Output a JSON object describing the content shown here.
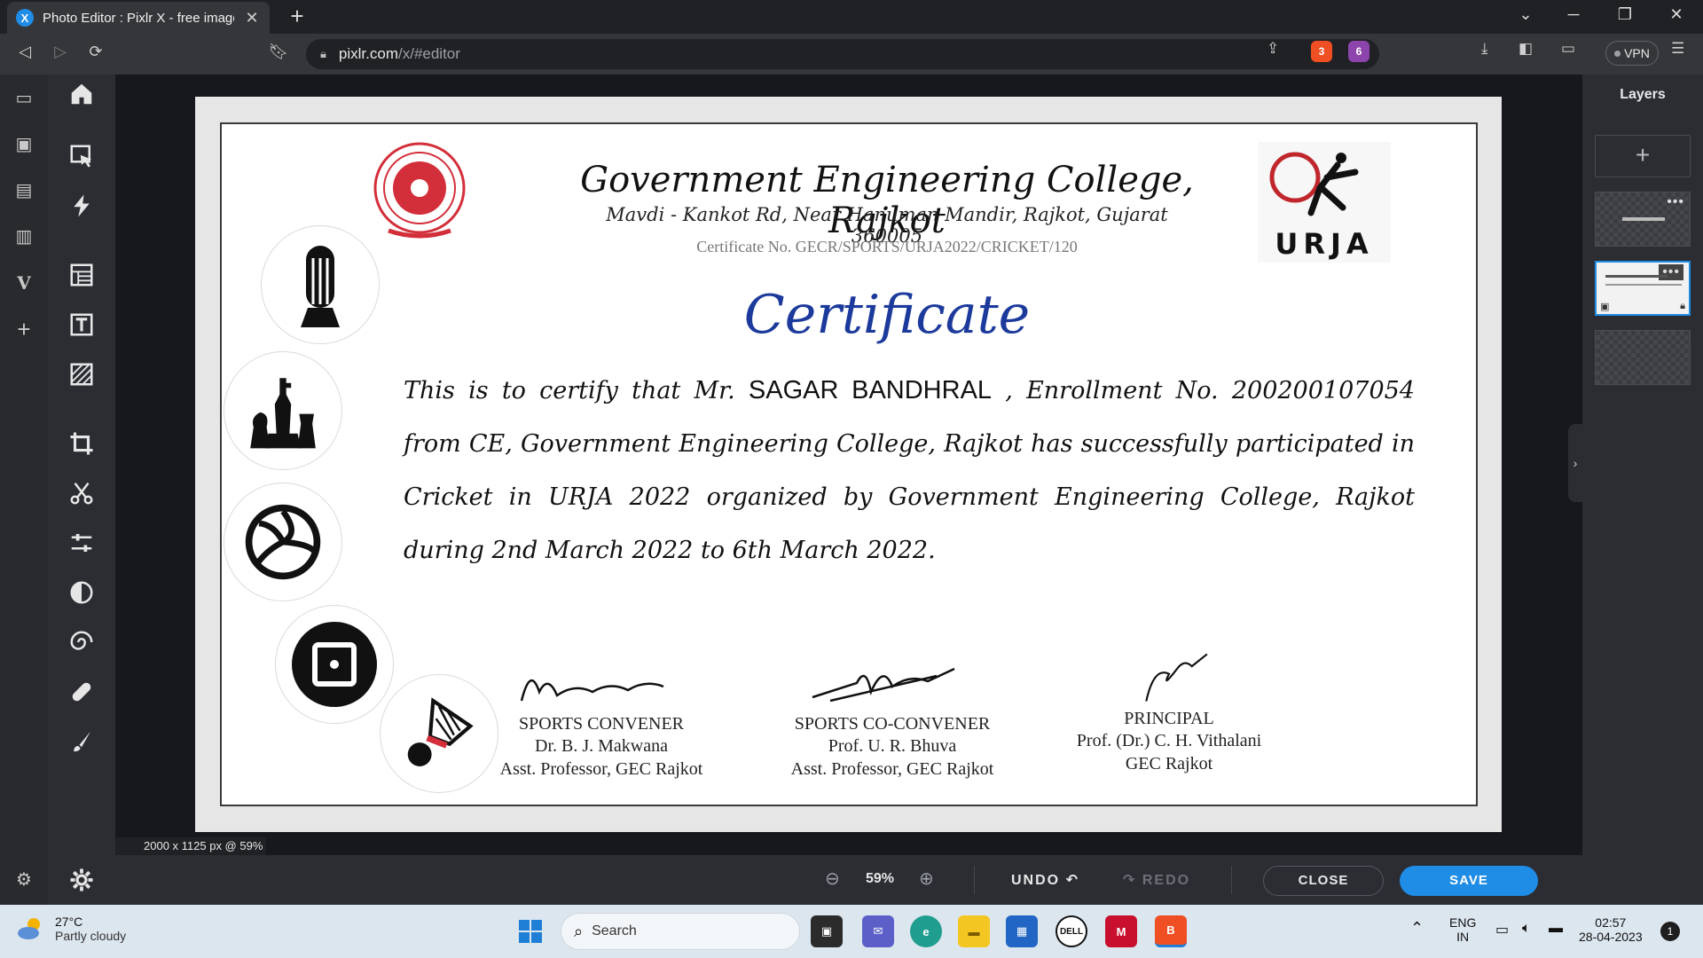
{
  "browser": {
    "tab_title": "Photo Editor : Pixlr X - free image",
    "url_host": "pixlr.com",
    "url_path": "/x/#editor",
    "brave_shield_count": "3",
    "rewards_count": "6",
    "vpn_label": "VPN"
  },
  "editor": {
    "canvas_info": "2000 x 1125 px @ 59%",
    "zoom_label": "59%",
    "undo_label": "UNDO",
    "redo_label": "REDO",
    "close_label": "CLOSE",
    "save_label": "SAVE",
    "layers_title": "Layers",
    "add_layer_symbol": "+"
  },
  "certificate": {
    "college_title": "Government Engineering College, Rajkot",
    "address": "Mavdi - Kankot Rd, Near Hanuman Mandir, Rajkot, Gujarat 360005",
    "certificate_number": "Certificate No. GECR/SPORTS/URJA2022/CRICKET/120",
    "heading": "Certificate",
    "body_part1": "This is to certify that Mr.",
    "student_name": "SAGAR BANDHRAL",
    "body_part2": ", Enrollment No. 200200107054 from CE, Government Engineering College, Rajkot has successfully participated in Cricket in URJA 2022 organized by Government Engineering College, Rajkot during 2nd March 2022 to 6th March 2022.",
    "urja_logo_text": "URJA",
    "signatories": [
      {
        "role": "SPORTS CONVENER",
        "name": "Dr. B. J. Makwana",
        "designation": "Asst. Professor, GEC Rajkot"
      },
      {
        "role": "SPORTS CO-CONVENER",
        "name": "Prof. U. R. Bhuva",
        "designation": "Asst. Professor, GEC Rajkot"
      },
      {
        "role": "PRINCIPAL",
        "name": "Prof. (Dr.) C. H. Vithalani",
        "designation": "GEC Rajkot"
      }
    ]
  },
  "taskbar": {
    "temperature": "27°C",
    "weather": "Partly cloudy",
    "search_label": "Search",
    "language_top": "ENG",
    "language_bottom": "IN",
    "time": "02:57",
    "date": "28-04-2023",
    "notification_count": "1"
  }
}
